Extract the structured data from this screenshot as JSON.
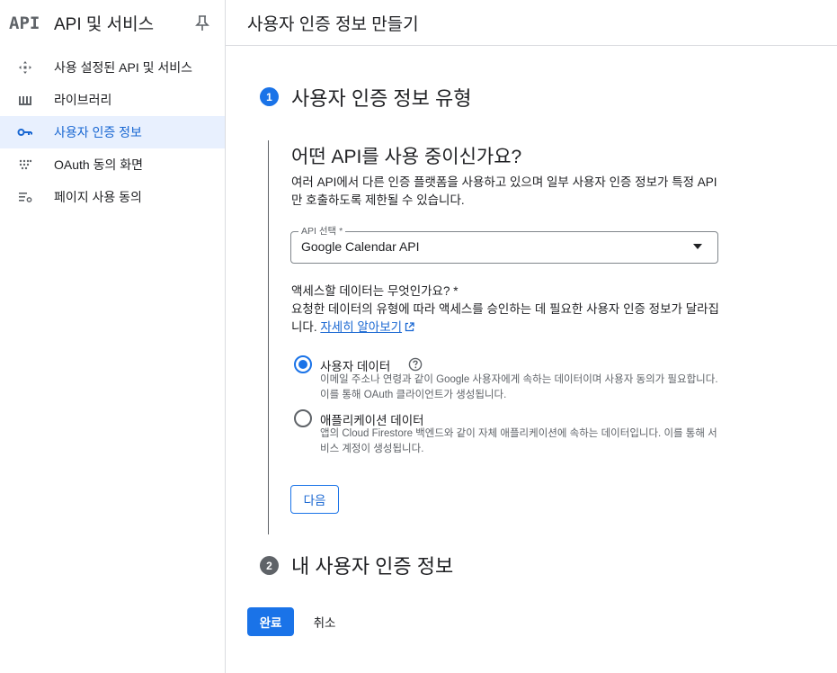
{
  "sidebar": {
    "logo": "API",
    "title": "API 및 서비스",
    "items": [
      {
        "label": "사용 설정된 API 및 서비스",
        "icon": "enabled-apis-icon"
      },
      {
        "label": "라이브러리",
        "icon": "library-icon"
      },
      {
        "label": "사용자 인증 정보",
        "icon": "key-icon"
      },
      {
        "label": "OAuth 동의 화면",
        "icon": "oauth-dots-icon"
      },
      {
        "label": "페이지 사용 동의",
        "icon": "settings-list-icon"
      }
    ],
    "active_index": 2
  },
  "header": {
    "title": "사용자 인증 정보 만들기"
  },
  "steps": [
    {
      "number": "1",
      "title": "사용자 인증 정보 유형"
    },
    {
      "number": "2",
      "title": "내 사용자 인증 정보"
    }
  ],
  "step1": {
    "question": "어떤 API를 사용 중이신가요?",
    "description": "여러 API에서 다른 인증 플랫폼을 사용하고 있으며 일부 사용자 인증 정보가 특정 API만 호출하도록 제한될 수 있습니다.",
    "select": {
      "label": "API 선택 *",
      "value": "Google Calendar API"
    },
    "access_question": "액세스할 데이터는 무엇인가요? *",
    "access_description": "요청한 데이터의 유형에 따라 액세스를 승인하는 데 필요한 사용자 인증 정보가 달라집니다.",
    "learn_more": "자세히 알아보기",
    "options": [
      {
        "label": "사용자 데이터",
        "description": "이메일 주소나 연령과 같이 Google 사용자에게 속하는 데이터이며 사용자 동의가 필요합니다. 이를 통해 OAuth 클라이언트가 생성됩니다.",
        "selected": true
      },
      {
        "label": "애플리케이션 데이터",
        "description": "앱의 Cloud Firestore 백엔드와 같이 자체 애플리케이션에 속하는 데이터입니다. 이를 통해 서비스 계정이 생성됩니다.",
        "selected": false
      }
    ],
    "next_label": "다음"
  },
  "footer": {
    "done_label": "완료",
    "cancel_label": "취소"
  },
  "colors": {
    "accent": "#1a73e8",
    "active_bg": "#e8f0fe",
    "border": "#dadce0"
  }
}
